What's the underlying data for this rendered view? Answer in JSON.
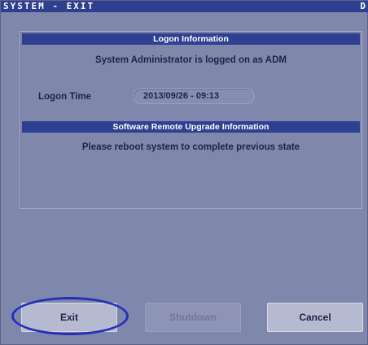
{
  "window": {
    "title": "SYSTEM - EXIT",
    "title_edge": "D"
  },
  "logon": {
    "header": "Logon Information",
    "message": "System Administrator is logged on as ADM",
    "time_label": "Logon Time",
    "time_value": "2013/09/26 - 09:13"
  },
  "upgrade": {
    "header": "Software Remote Upgrade Information",
    "message": "Please reboot system to complete previous state"
  },
  "buttons": {
    "exit": "Exit",
    "shutdown": "Shutdown",
    "cancel": "Cancel"
  },
  "colors": {
    "window_background": "#8087ad",
    "header_bar": "#2f3f91",
    "button_face": "#b6bad0",
    "highlight_ellipse": "#2430b8"
  }
}
